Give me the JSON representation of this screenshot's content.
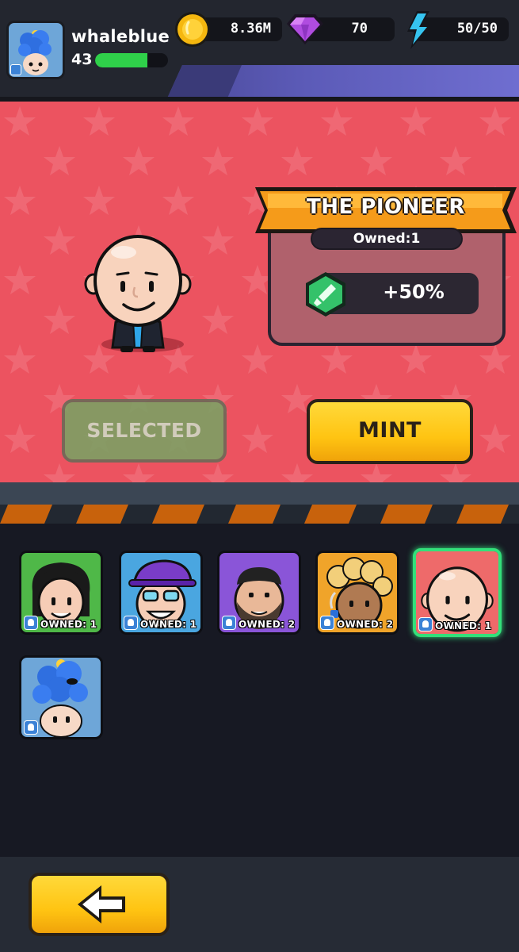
{
  "player": {
    "username": "whaleblue",
    "level": "43",
    "xp_progress": 0.72
  },
  "currencies": {
    "coins": "8.36M",
    "gems": "70",
    "energy": "50/50"
  },
  "character": {
    "name": "THE PIONEER",
    "owned": "Owned:1",
    "bonus": "+50%"
  },
  "buttons": {
    "selected_label": "SELECTED",
    "mint_label": "MINT"
  },
  "cards": [
    {
      "owned": "OWNED: 1",
      "bg": "#4fb848",
      "icon": "long-hair-guy-portrait-icon"
    },
    {
      "owned": "OWNED: 1",
      "bg": "#4aa6e0",
      "icon": "purple-cap-guy-portrait-icon"
    },
    {
      "owned": "OWNED: 2",
      "bg": "#8a55d8",
      "icon": "bearded-guy-portrait-icon"
    },
    {
      "owned": "OWNED: 2",
      "bg": "#f0a42a",
      "icon": "curly-hair-guy-portrait-icon"
    },
    {
      "owned": "OWNED: 1",
      "bg": "#ee6a6a",
      "icon": "bald-guy-portrait-icon",
      "selected": true
    },
    {
      "owned": "",
      "bg": "#6ea6d8",
      "icon": "blue-blob-hat-portrait-icon"
    }
  ],
  "colors": {
    "showcase_bg": "#ec5360",
    "mint_yellow": "#ffc412",
    "selected_green": "#7da064",
    "xp_green": "#2fd04a",
    "selected_border": "#33e07a"
  }
}
